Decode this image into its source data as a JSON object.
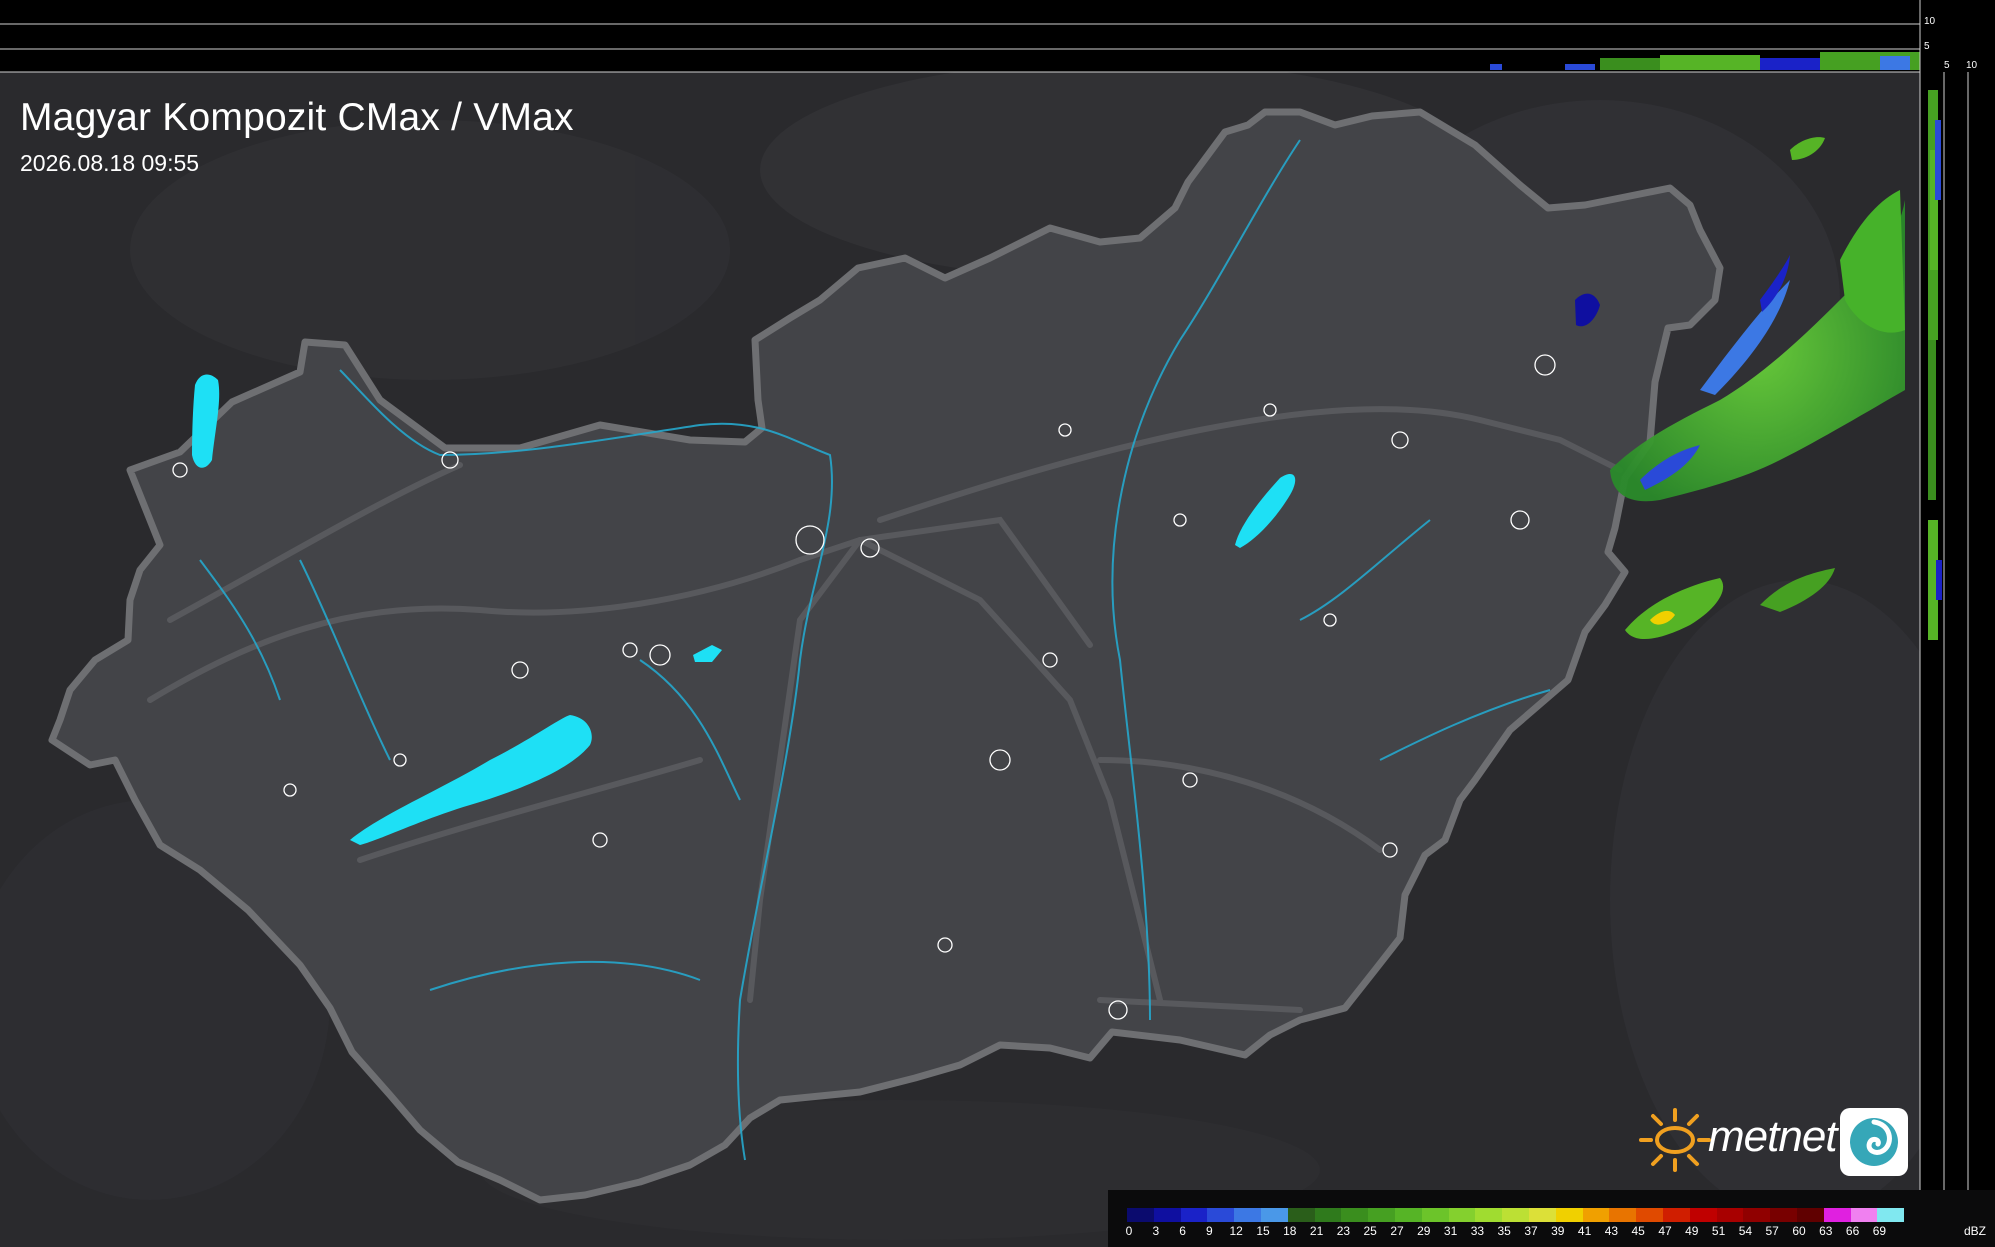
{
  "header": {
    "title": "Magyar Kompozit CMax / VMax",
    "timestamp": "2026.08.18 09:55"
  },
  "profile_axes": {
    "top_ticks": [
      "10",
      "5"
    ],
    "side_ticks": [
      "5",
      "10"
    ]
  },
  "legend": {
    "unit": "dBZ",
    "labels": [
      "0",
      "3",
      "6",
      "9",
      "12",
      "15",
      "18",
      "21",
      "23",
      "25",
      "27",
      "29",
      "31",
      "33",
      "35",
      "37",
      "39",
      "41",
      "43",
      "45",
      "47",
      "49",
      "51",
      "54",
      "57",
      "60",
      "63",
      "66",
      "69"
    ],
    "colors": [
      "#0b0b6e",
      "#0f0fa0",
      "#1a22c8",
      "#2a4ad8",
      "#3c78e4",
      "#4a98e8",
      "#2a5e1a",
      "#2f7a1c",
      "#3a8e1e",
      "#46a022",
      "#56b426",
      "#6cc42a",
      "#84d02e",
      "#a0dc30",
      "#bce034",
      "#dce038",
      "#f0d000",
      "#f0a000",
      "#e87400",
      "#e04a00",
      "#d01e00",
      "#c00000",
      "#a80000",
      "#900000",
      "#780000",
      "#600000",
      "#e020e0",
      "#f080f0",
      "#80e8f0"
    ]
  },
  "brand": {
    "name": "metnet",
    "logo_icon": "sun-icon",
    "badge_icon": "swirl-icon"
  },
  "colors": {
    "background": "#2b2b2e",
    "country": "#424347",
    "border": "#6f7073",
    "water": "#1ee0f5",
    "rivers": "#26a7cc"
  }
}
